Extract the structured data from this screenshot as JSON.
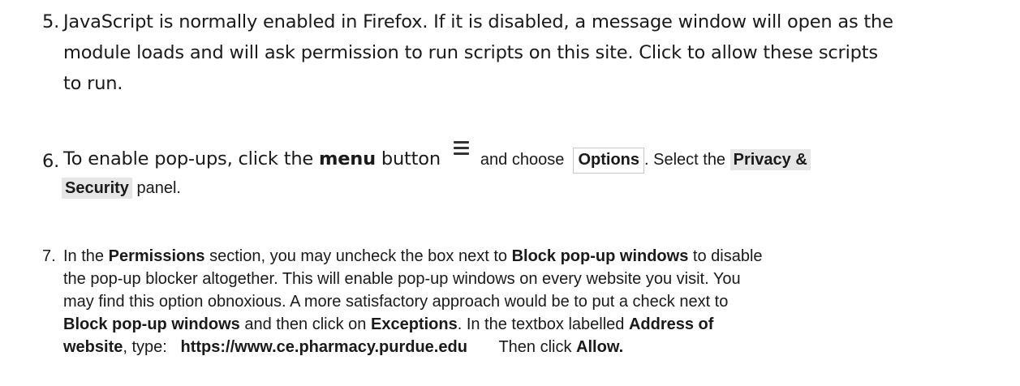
{
  "step5": {
    "number": "5.",
    "lines": [
      "JavaScript is normally enabled in Firefox. If it is disabled, a message window will open as the",
      "module loads and will ask permission to run scripts on this site.  Click to allow these scripts",
      "to run."
    ]
  },
  "step6": {
    "number": "6.",
    "t1": "To enable pop-ups, click the",
    "menu_word": "menu",
    "t2": "button",
    "menu_icon": "hamburger-menu-icon",
    "t3": "and choose",
    "options_label": "Options",
    "t4": ".  Select the",
    "privacy_part1": "Privacy &",
    "privacy_part2": "Security",
    "t5": "panel."
  },
  "step7": {
    "number": "7.",
    "l1a": "In the",
    "permissions": "Permissions",
    "l1b": "section, you may uncheck the box next to",
    "block_popups": "Block pop-up windows",
    "l1c": "to disable",
    "l2": "the pop-up blocker altogether. This will enable pop-up windows on every website you visit. You",
    "l3": "may find this option obnoxious. A more satisfactory approach would be to put a check next to",
    "block_popups_2": "Block pop-up windows",
    "l4a": "and then click on",
    "exceptions": "Exceptions",
    "l4b": ". In the textbox labelled",
    "address_label_1": "Address of",
    "address_label_2": "website",
    "l5a": ", type:",
    "url": "https://www.ce.pharmacy.purdue.edu",
    "l5b": "Then click",
    "allow": "Allow."
  }
}
